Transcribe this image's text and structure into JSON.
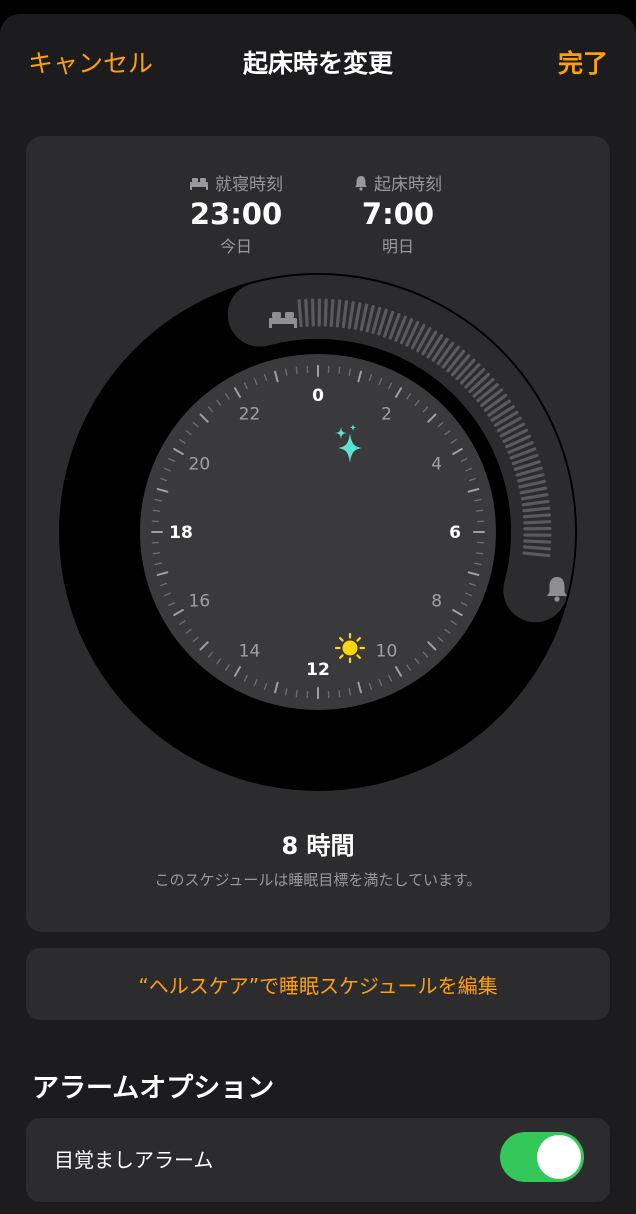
{
  "nav": {
    "cancel": "キャンセル",
    "title": "起床時を変更",
    "done": "完了"
  },
  "schedule": {
    "bedtime": {
      "label": "就寝時刻",
      "time": "23:00",
      "day": "今日"
    },
    "wake": {
      "label": "起床時刻",
      "time": "7:00",
      "day": "明日"
    },
    "duration": "8 時間",
    "message": "このスケジュールは睡眠目標を満たしています。"
  },
  "clock": {
    "hour_labels": [
      "0",
      "2",
      "4",
      "6",
      "8",
      "10",
      "12",
      "14",
      "16",
      "18",
      "20",
      "22"
    ],
    "bedtime_hour": 23,
    "wake_hour": 7
  },
  "health_link": "“ヘルスケア”で睡眠スケジュールを編集",
  "alarm": {
    "section_title": "アラームオプション",
    "wake_alarm_label": "目覚ましアラーム",
    "wake_alarm_on": true
  },
  "colors": {
    "accent": "#ff9f0a",
    "toggle_on": "#34c759",
    "sparkle": "#5ce1d6",
    "sun": "#ffd60a"
  }
}
